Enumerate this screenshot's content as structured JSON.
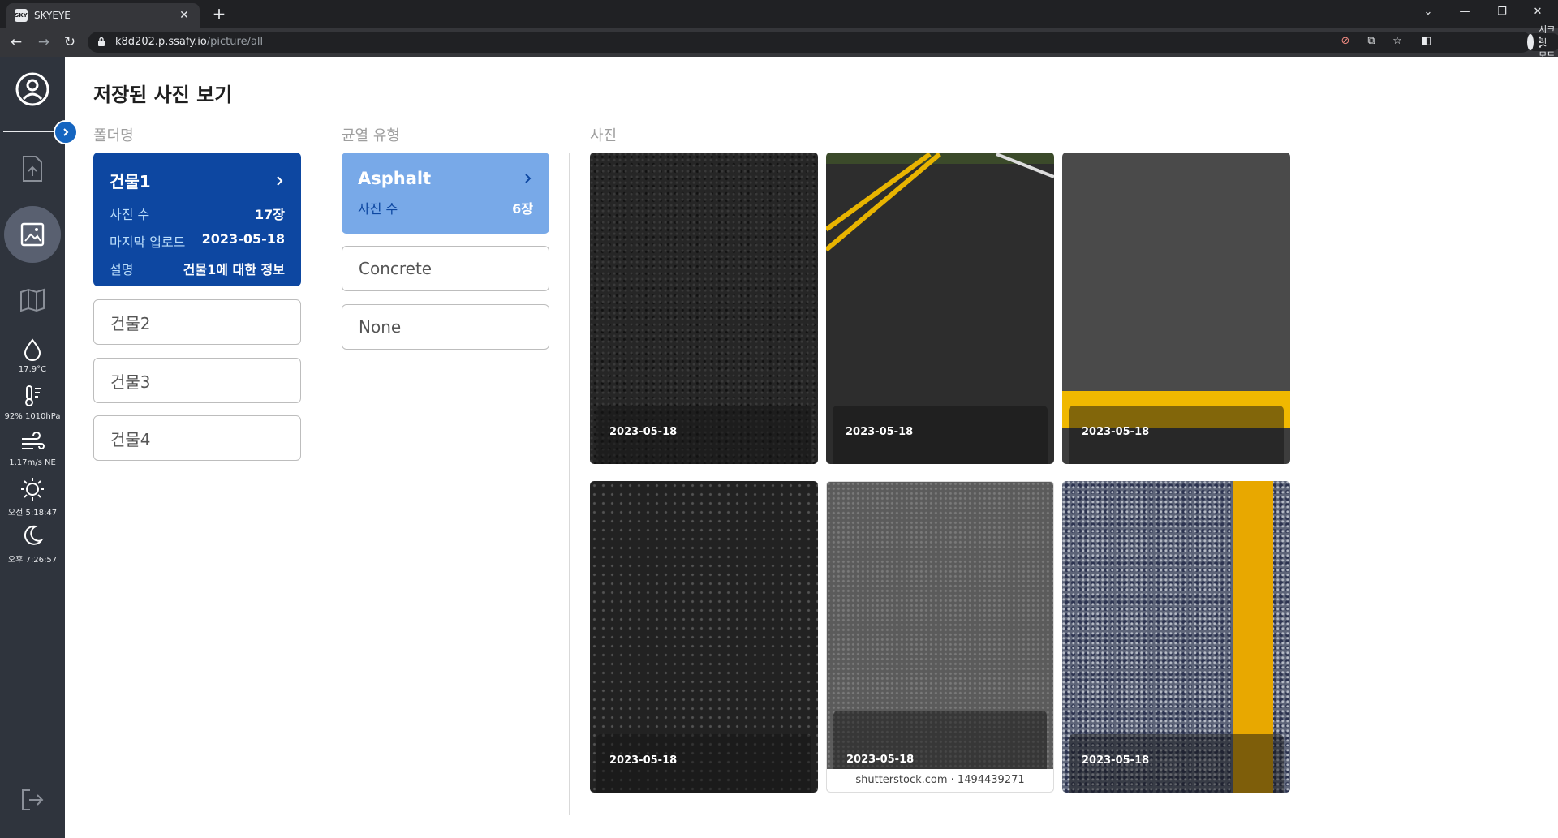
{
  "browser": {
    "tab_title": "SKYEYE",
    "favicon_text": "SKY",
    "url_host": "k8d202.p.ssafy.io",
    "url_path": "/picture/all",
    "incognito_label": "시크릿 모드"
  },
  "sidebar": {
    "icons": [
      "profile-icon",
      "upload-icon",
      "gallery-icon",
      "map-icon",
      "droplet-icon",
      "thermometer-icon",
      "wind-icon",
      "sunrise-icon",
      "moon-icon",
      "logout-icon"
    ],
    "weather": {
      "temperature": "17.9°C",
      "humidity_pressure": "92% 1010hPa",
      "wind": "1.17m/s NE",
      "sunrise": "오전 5:18:47",
      "sunset": "오후 7:26:57"
    },
    "accent_color": "#1565c0"
  },
  "page": {
    "title": "저장된 사진 보기"
  },
  "folders": {
    "header": "폴더명",
    "active": {
      "name": "건물1",
      "photo_count_label": "사진 수",
      "photo_count": "17장",
      "last_upload_label": "마지막 업로드",
      "last_upload": "2023-05-18",
      "description_label": "설명",
      "description": "건물1에 대한 정보"
    },
    "items": [
      "건물2",
      "건물3",
      "건물4"
    ],
    "active_color": "#0d47a1"
  },
  "crack_types": {
    "header": "균열 유형",
    "active": {
      "name": "Asphalt",
      "photo_count_label": "사진 수",
      "photo_count": "6장"
    },
    "items": [
      "Concrete",
      "None"
    ],
    "active_color": "#78a9e8"
  },
  "photos": {
    "header": "사진",
    "items": [
      {
        "date": "2023-05-18"
      },
      {
        "date": "2023-05-18"
      },
      {
        "date": "2023-05-18"
      },
      {
        "date": "2023-05-18"
      },
      {
        "date": "2023-05-18",
        "watermark": "shutterstock.com · 1494439271"
      },
      {
        "date": "2023-05-18"
      }
    ]
  }
}
